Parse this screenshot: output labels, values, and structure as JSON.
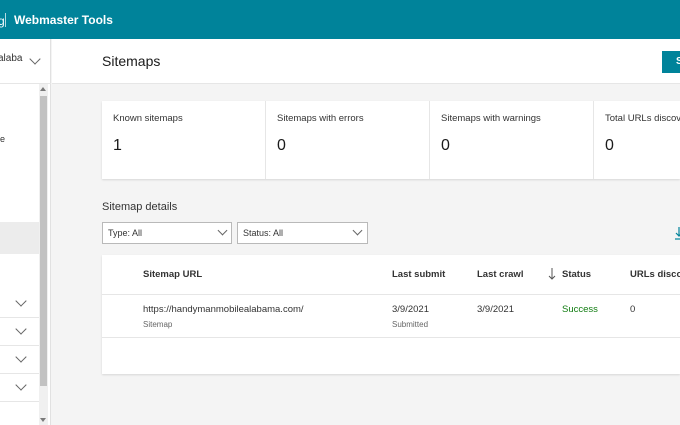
{
  "topbar": {
    "brand_fragment": "g",
    "app_title": "Webmaster Tools"
  },
  "sidebar": {
    "site_name_fragment": "alaba",
    "nav_fragment": "e"
  },
  "main": {
    "page_title": "Sitemaps",
    "submit_button_fragment": "S"
  },
  "stats": [
    {
      "label": "Known sitemaps",
      "value": "1"
    },
    {
      "label": "Sitemaps with errors",
      "value": "0"
    },
    {
      "label": "Sitemaps with warnings",
      "value": "0"
    },
    {
      "label": "Total URLs discov",
      "value": "0"
    }
  ],
  "details": {
    "title": "Sitemap details",
    "type_filter": "Type: All",
    "status_filter": "Status: All"
  },
  "table": {
    "columns": [
      "Sitemap URL",
      "Last submit",
      "Last crawl",
      "Status",
      "URLs discov"
    ],
    "rows": [
      {
        "url": "https://handymanmobilealabama.com/",
        "kind": "Sitemap",
        "last_submit": "3/9/2021",
        "submit_note": "Submitted",
        "last_crawl": "3/9/2021",
        "status": "Success",
        "urls": "0"
      }
    ]
  },
  "colors": {
    "accent": "#00839a",
    "success": "#107c10"
  }
}
